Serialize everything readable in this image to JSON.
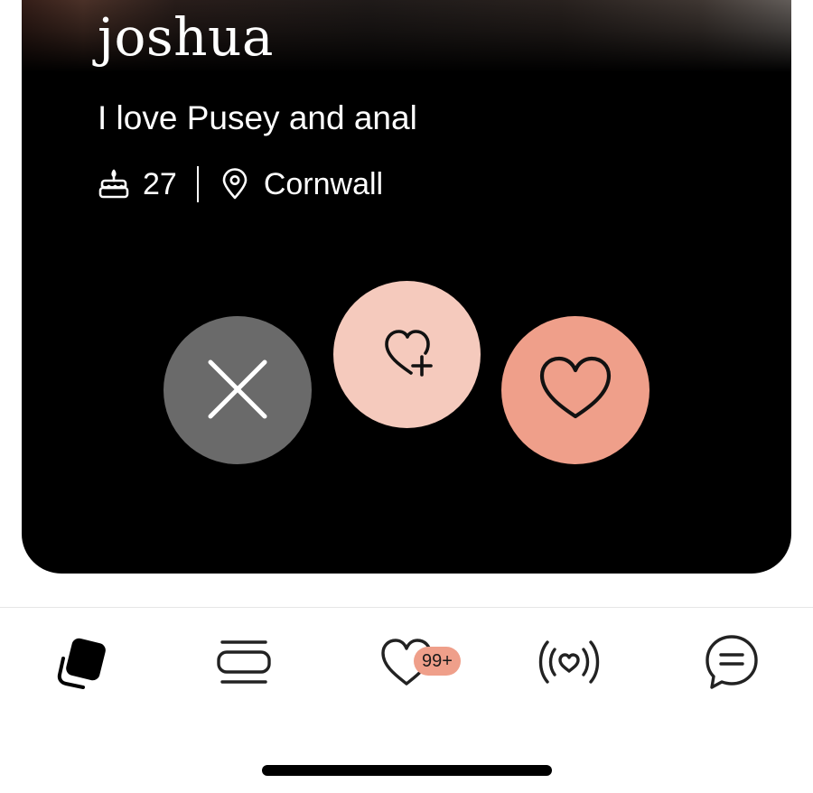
{
  "profile": {
    "name": "joshua",
    "bio": "I love Pusey and anal",
    "age": "27",
    "location": "Cornwall"
  },
  "actions": {
    "pass_icon": "close-icon",
    "superlike_icon": "heart-plus-icon",
    "like_icon": "heart-icon"
  },
  "tabbar": {
    "tabs": [
      {
        "icon": "cards-stack-icon",
        "active": true
      },
      {
        "icon": "stack-icon",
        "active": false
      },
      {
        "icon": "heart-icon",
        "active": false
      },
      {
        "icon": "broadcast-heart-icon",
        "active": false
      },
      {
        "icon": "chat-icon",
        "active": false
      }
    ],
    "likes_badge": "99+"
  },
  "colors": {
    "pass": "#6a6a6a",
    "superlike": "#f5cabd",
    "like": "#ef9f8a",
    "card": "#000000"
  }
}
